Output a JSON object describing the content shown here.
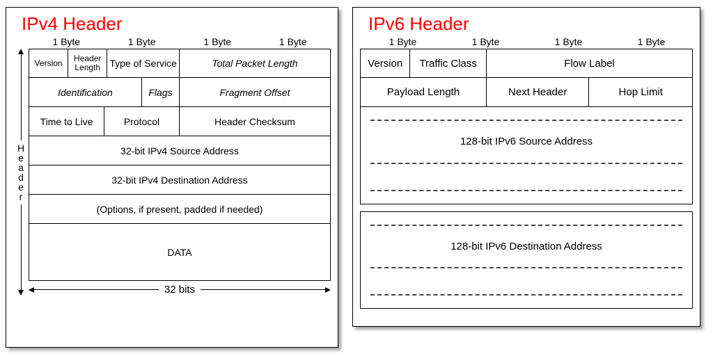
{
  "ipv4": {
    "title": "IPv4 Header",
    "bytes": [
      "1 Byte",
      "1 Byte",
      "1 Byte",
      "1 Byte"
    ],
    "vlabel": [
      "H",
      "e",
      "a",
      "d",
      "e",
      "r"
    ],
    "rows": {
      "r1": {
        "version": "Version",
        "hlen": "Header Length",
        "tos": "Type of Service",
        "tpl": "Total Packet Length"
      },
      "r2": {
        "ident": "Identification",
        "flags": "Flags",
        "frag": "Fragment Offset"
      },
      "r3": {
        "ttl": "Time to Live",
        "proto": "Protocol",
        "chk": "Header Checksum"
      },
      "src": "32-bit IPv4 Source Address",
      "dst": "32-bit IPv4 Destination Address",
      "opts": "(Options, if present, padded if needed)",
      "data": "DATA"
    },
    "bits": "32 bits"
  },
  "ipv6": {
    "title": "IPv6 Header",
    "bytes": [
      "1 Byte",
      "1 Byte",
      "1 Byte",
      "1 Byte"
    ],
    "rows": {
      "r1": {
        "version": "Version",
        "tclass": "Traffic Class",
        "flow": "Flow Label"
      },
      "r2": {
        "plen": "Payload Length",
        "nhdr": "Next Header",
        "hop": "Hop Limit"
      },
      "src": "128-bit IPv6 Source Address",
      "dst": "128-bit IPv6 Destination Address"
    }
  }
}
